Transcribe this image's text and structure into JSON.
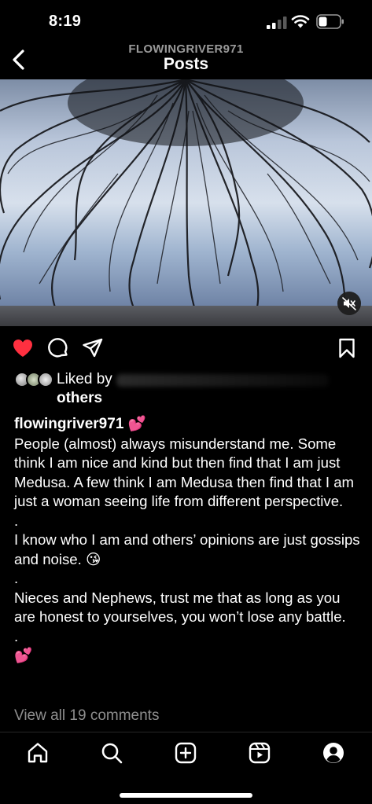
{
  "status_bar": {
    "time": "8:19",
    "icons": [
      "signal-icon",
      "wifi-icon",
      "battery-icon"
    ]
  },
  "header": {
    "username": "FLOWINGRIVER971",
    "title": "Posts",
    "back_icon": "chevron-left-icon"
  },
  "post": {
    "media_icon": "muted-speaker-icon",
    "actions": [
      "heart-icon",
      "comment-icon",
      "share-icon",
      "bookmark-icon"
    ],
    "liked": true,
    "like_color": "#ff3040",
    "liked_by_label": "Liked by",
    "others_label": "others",
    "caption": {
      "username": "flowingriver971",
      "username_emoji": "💕",
      "paragraph_1": "People (almost) always misunderstand me. Some think I am nice and kind but then find that I am just Medusa. A few think I am Medusa then find that I am just a woman seeing life from different perspective.",
      "dot_1": ".",
      "paragraph_2": "I know who I am and others’ opinions are just gossips and noise. 😘",
      "dot_2": ".",
      "paragraph_3": "Nieces and Nephews, trust me that as long as you are honest to yourselves, you won’t lose any battle.",
      "dot_3": ".",
      "closing_emoji": "💕"
    },
    "view_comments": "View all 19 comments"
  },
  "tab_bar": {
    "tabs": [
      "home-icon",
      "search-icon",
      "create-icon",
      "reels-icon",
      "profile-icon"
    ]
  }
}
